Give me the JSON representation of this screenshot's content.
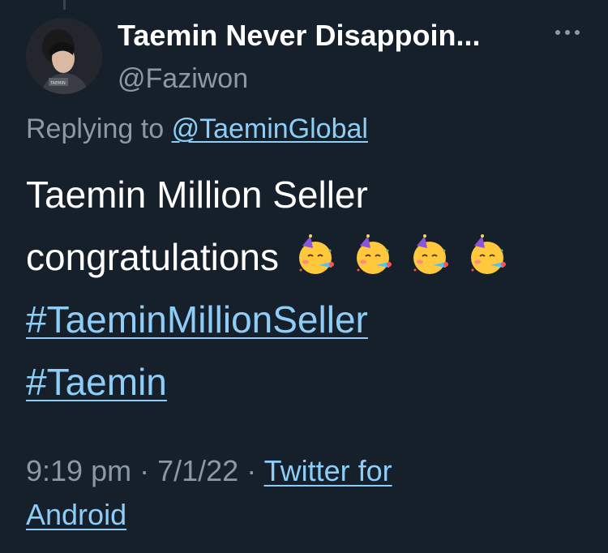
{
  "tweet": {
    "display_name": "Taemin Never Disappoin...",
    "handle": "@Faziwon",
    "more_icon": "more-horizontal-icon",
    "avatar_icon": "profile-avatar",
    "replying_prefix": "Replying to",
    "replying_to": "@TaeminGlobal",
    "text_line_1": "Taemin Million Seller",
    "text_line_2": "congratulations",
    "emoji": [
      "partying-face-emoji",
      "partying-face-emoji",
      "partying-face-emoji",
      "partying-face-emoji"
    ],
    "hashtags": [
      "#TaeminMillionSeller",
      "#Taemin"
    ],
    "time": "9:19 pm",
    "separator": "·",
    "date": "7/1/22",
    "source_line_1": "Twitter for",
    "source_line_2": "Android"
  },
  "colors": {
    "background": "#15202b",
    "text": "#ffffff",
    "secondary_text": "#8b98a5",
    "link": "#8ecdf8"
  }
}
